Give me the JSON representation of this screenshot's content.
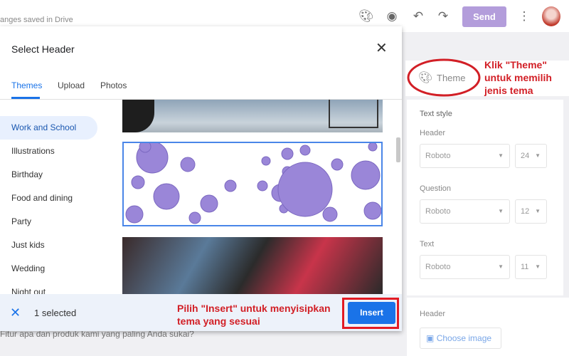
{
  "topbar": {
    "saved_text": "anges saved in Drive",
    "send_label": "Send",
    "icons": [
      "palette-icon",
      "eye-icon",
      "undo-icon",
      "redo-icon",
      "more-vert-icon"
    ]
  },
  "dialog": {
    "title": "Select Header",
    "tabs": [
      {
        "label": "Themes",
        "active": true
      },
      {
        "label": "Upload"
      },
      {
        "label": "Photos"
      }
    ],
    "categories": [
      {
        "label": "Work and School",
        "selected": true
      },
      {
        "label": "Illustrations"
      },
      {
        "label": "Birthday"
      },
      {
        "label": "Food and dining"
      },
      {
        "label": "Party"
      },
      {
        "label": "Just kids"
      },
      {
        "label": "Wedding"
      },
      {
        "label": "Night out"
      }
    ],
    "selected_count": "1 selected",
    "insert_label": "Insert"
  },
  "annotations": {
    "theme_note": "Klik \"Theme\" untuk memilih jenis tema",
    "insert_note": "Pilih \"Insert\" untuk menyisipkan tema yang sesuai"
  },
  "panel": {
    "theme_label": "Theme",
    "text_style": "Text style",
    "header_label": "Header",
    "header_font": "Roboto",
    "header_size": "24",
    "question_label": "Question",
    "question_font": "Roboto",
    "question_size": "12",
    "text_label": "Text",
    "text_font": "Roboto",
    "text_size": "11",
    "header_section": "Header",
    "choose_image": "Choose image"
  },
  "form": {
    "question_text": "Fitur apa dan produk kami yang paling Anda sukai?"
  },
  "colors": {
    "accent": "#1a73e8",
    "send": "#b39ddb",
    "annotation": "#d21f26"
  }
}
